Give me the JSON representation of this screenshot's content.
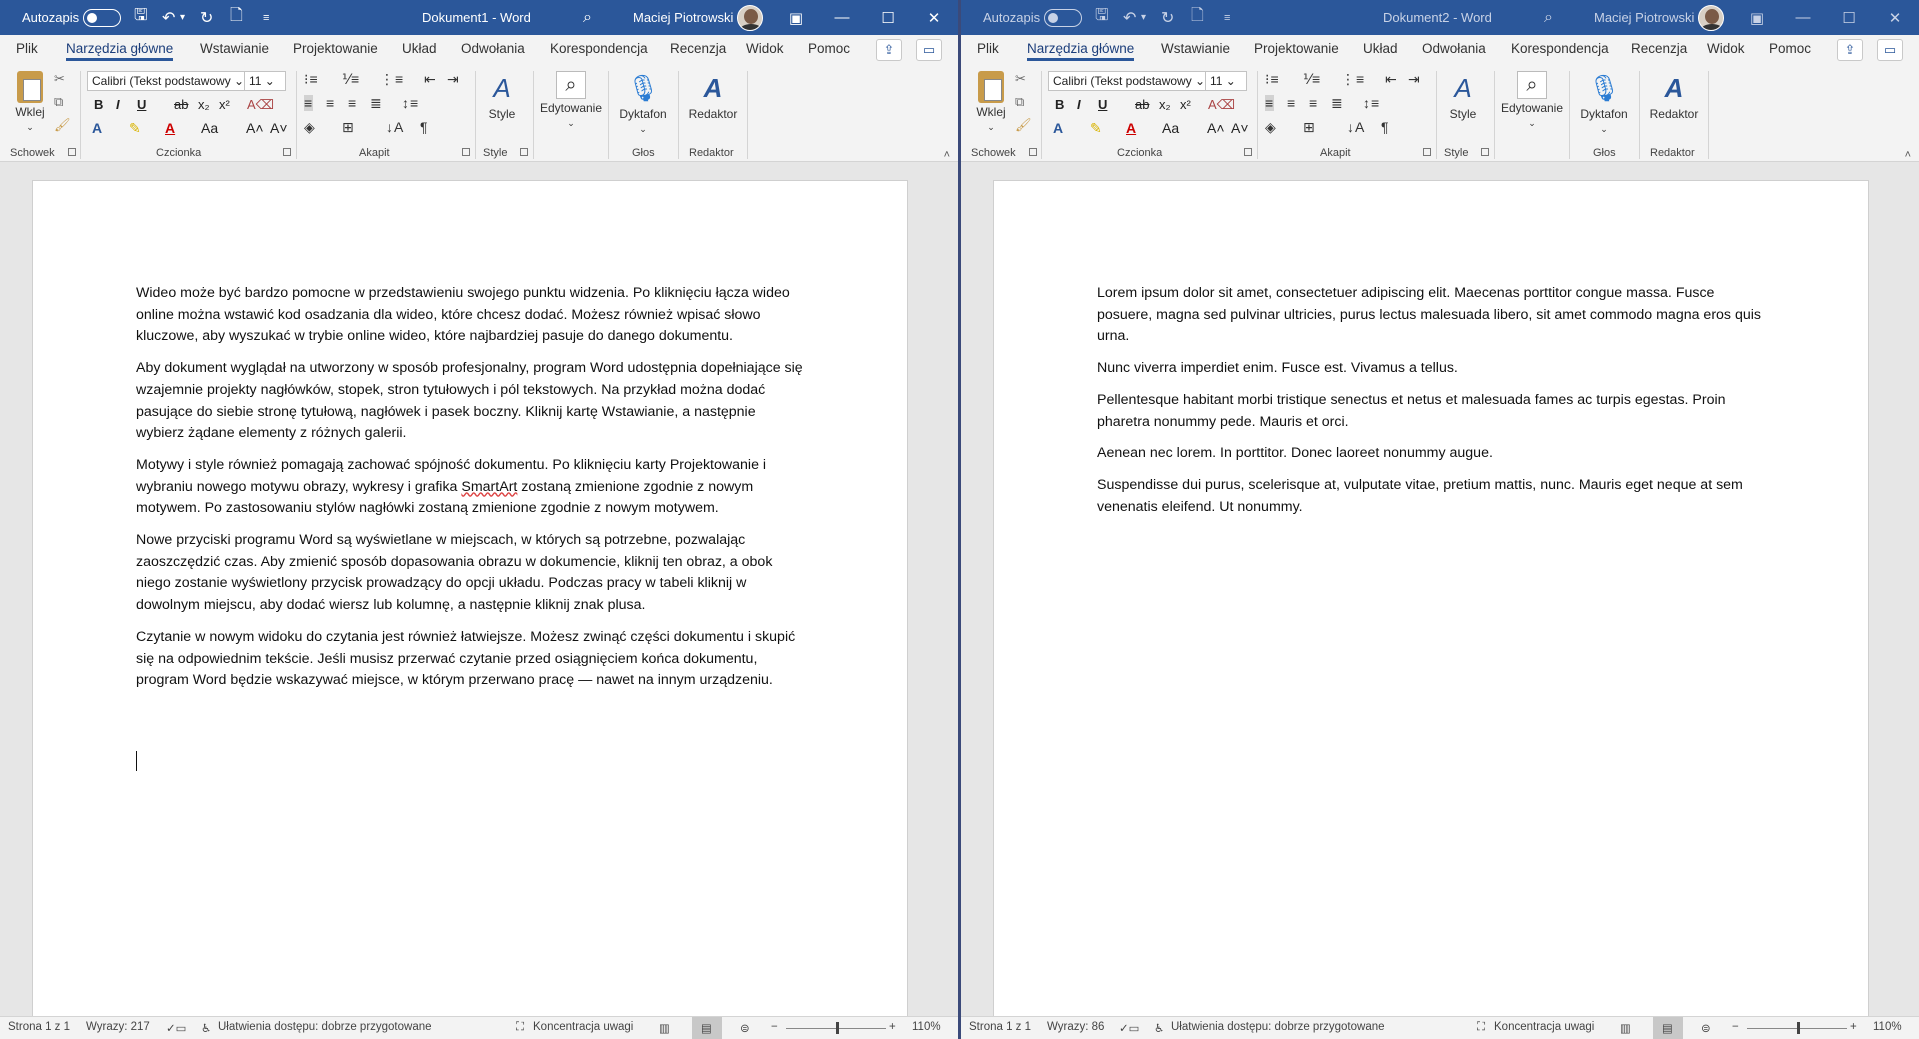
{
  "windows": [
    {
      "titlebar": {
        "autosave_label": "Autozapis",
        "doc_title": "Dokument1  -  Word",
        "user_name": "Maciej Piotrowski"
      },
      "tabs": [
        "Plik",
        "Narzędzia główne",
        "Wstawianie",
        "Projektowanie",
        "Układ",
        "Odwołania",
        "Korespondencja",
        "Recenzja",
        "Widok",
        "Pomoc"
      ],
      "ribbon": {
        "paste_label": "Wklej",
        "font_name": "Calibri (Tekst podstawowy",
        "font_size": "11",
        "style_label": "Style",
        "edit_label": "Edytowanie",
        "dictate_label": "Dyktafon",
        "editor_label": "Redaktor",
        "groups": [
          "Schowek",
          "Czcionka",
          "Akapit",
          "Style",
          "Głos",
          "Redaktor"
        ]
      },
      "paragraphs": [
        "Wideo może być bardzo pomocne w przedstawieniu swojego punktu widzenia. Po kliknięciu łącza wideo online można wstawić kod osadzania dla wideo, które chcesz dodać. Możesz również wpisać słowo kluczowe, aby wyszukać w trybie online wideo, które najbardziej pasuje do danego dokumentu.",
        "Aby dokument wyglądał na utworzony w sposób profesjonalny, program Word udostępnia dopełniające się wzajemnie projekty nagłówków, stopek, stron tytułowych i pól tekstowych. Na przykład można dodać pasujące do siebie stronę tytułową, nagłówek i pasek boczny. Kliknij kartę Wstawianie, a następnie wybierz żądane elementy z różnych galerii.",
        "Motywy i style również pomagają zachować spójność dokumentu. Po kliknięciu karty Projektowanie i wybraniu nowego motywu obrazy, wykresy i grafika SmartArt zostaną zmienione zgodnie z nowym motywem. Po zastosowaniu stylów nagłówki zostaną zmienione zgodnie z nowym motywem.",
        "Nowe przyciski programu Word są wyświetlane w miejscach, w których są potrzebne, pozwalając zaoszczędzić czas. Aby zmienić sposób dopasowania obrazu w dokumencie, kliknij ten obraz, a obok niego zostanie wyświetlony przycisk prowadzący do opcji układu. Podczas pracy w tabeli kliknij w dowolnym miejscu, aby dodać wiersz lub kolumnę, a następnie kliknij znak plusa.",
        "Czytanie w nowym widoku do czytania jest również łatwiejsze. Możesz zwinąć części dokumentu i skupić się na odpowiednim tekście. Jeśli musisz przerwać czytanie przed osiągnięciem końca dokumentu, program Word będzie wskazywać miejsce, w którym przerwano pracę — nawet na innym urządzeniu."
      ],
      "status": {
        "page": "Strona 1 z 1",
        "words": "Wyrazy: 217",
        "accessibility": "Ułatwienia dostępu: dobrze przygotowane",
        "focus": "Koncentracja uwagi",
        "zoom": "110%"
      }
    },
    {
      "titlebar": {
        "autosave_label": "Autozapis",
        "doc_title": "Dokument2  -  Word",
        "user_name": "Maciej Piotrowski"
      },
      "tabs": [
        "Plik",
        "Narzędzia główne",
        "Wstawianie",
        "Projektowanie",
        "Układ",
        "Odwołania",
        "Korespondencja",
        "Recenzja",
        "Widok",
        "Pomoc"
      ],
      "ribbon": {
        "paste_label": "Wklej",
        "font_name": "Calibri (Tekst podstawowy",
        "font_size": "11",
        "style_label": "Style",
        "edit_label": "Edytowanie",
        "dictate_label": "Dyktafon",
        "editor_label": "Redaktor",
        "groups": [
          "Schowek",
          "Czcionka",
          "Akapit",
          "Style",
          "Głos",
          "Redaktor"
        ]
      },
      "paragraphs": [
        "Lorem ipsum dolor sit amet, consectetuer adipiscing elit. Maecenas porttitor congue massa. Fusce posuere, magna sed pulvinar ultricies, purus lectus malesuada libero, sit amet commodo magna eros quis urna.",
        "Nunc viverra imperdiet enim. Fusce est. Vivamus a tellus.",
        "Pellentesque habitant morbi tristique senectus et netus et malesuada fames ac turpis egestas. Proin pharetra nonummy pede. Mauris et orci.",
        "Aenean nec lorem. In porttitor. Donec laoreet nonummy augue.",
        "Suspendisse dui purus, scelerisque at, vulputate vitae, pretium mattis, nunc. Mauris eget neque at sem venenatis eleifend. Ut nonummy."
      ],
      "status": {
        "page": "Strona 1 z 1",
        "words": "Wyrazy: 86",
        "accessibility": "Ułatwienia dostępu: dobrze przygotowane",
        "focus": "Koncentracja uwagi",
        "zoom": "110%"
      }
    }
  ]
}
